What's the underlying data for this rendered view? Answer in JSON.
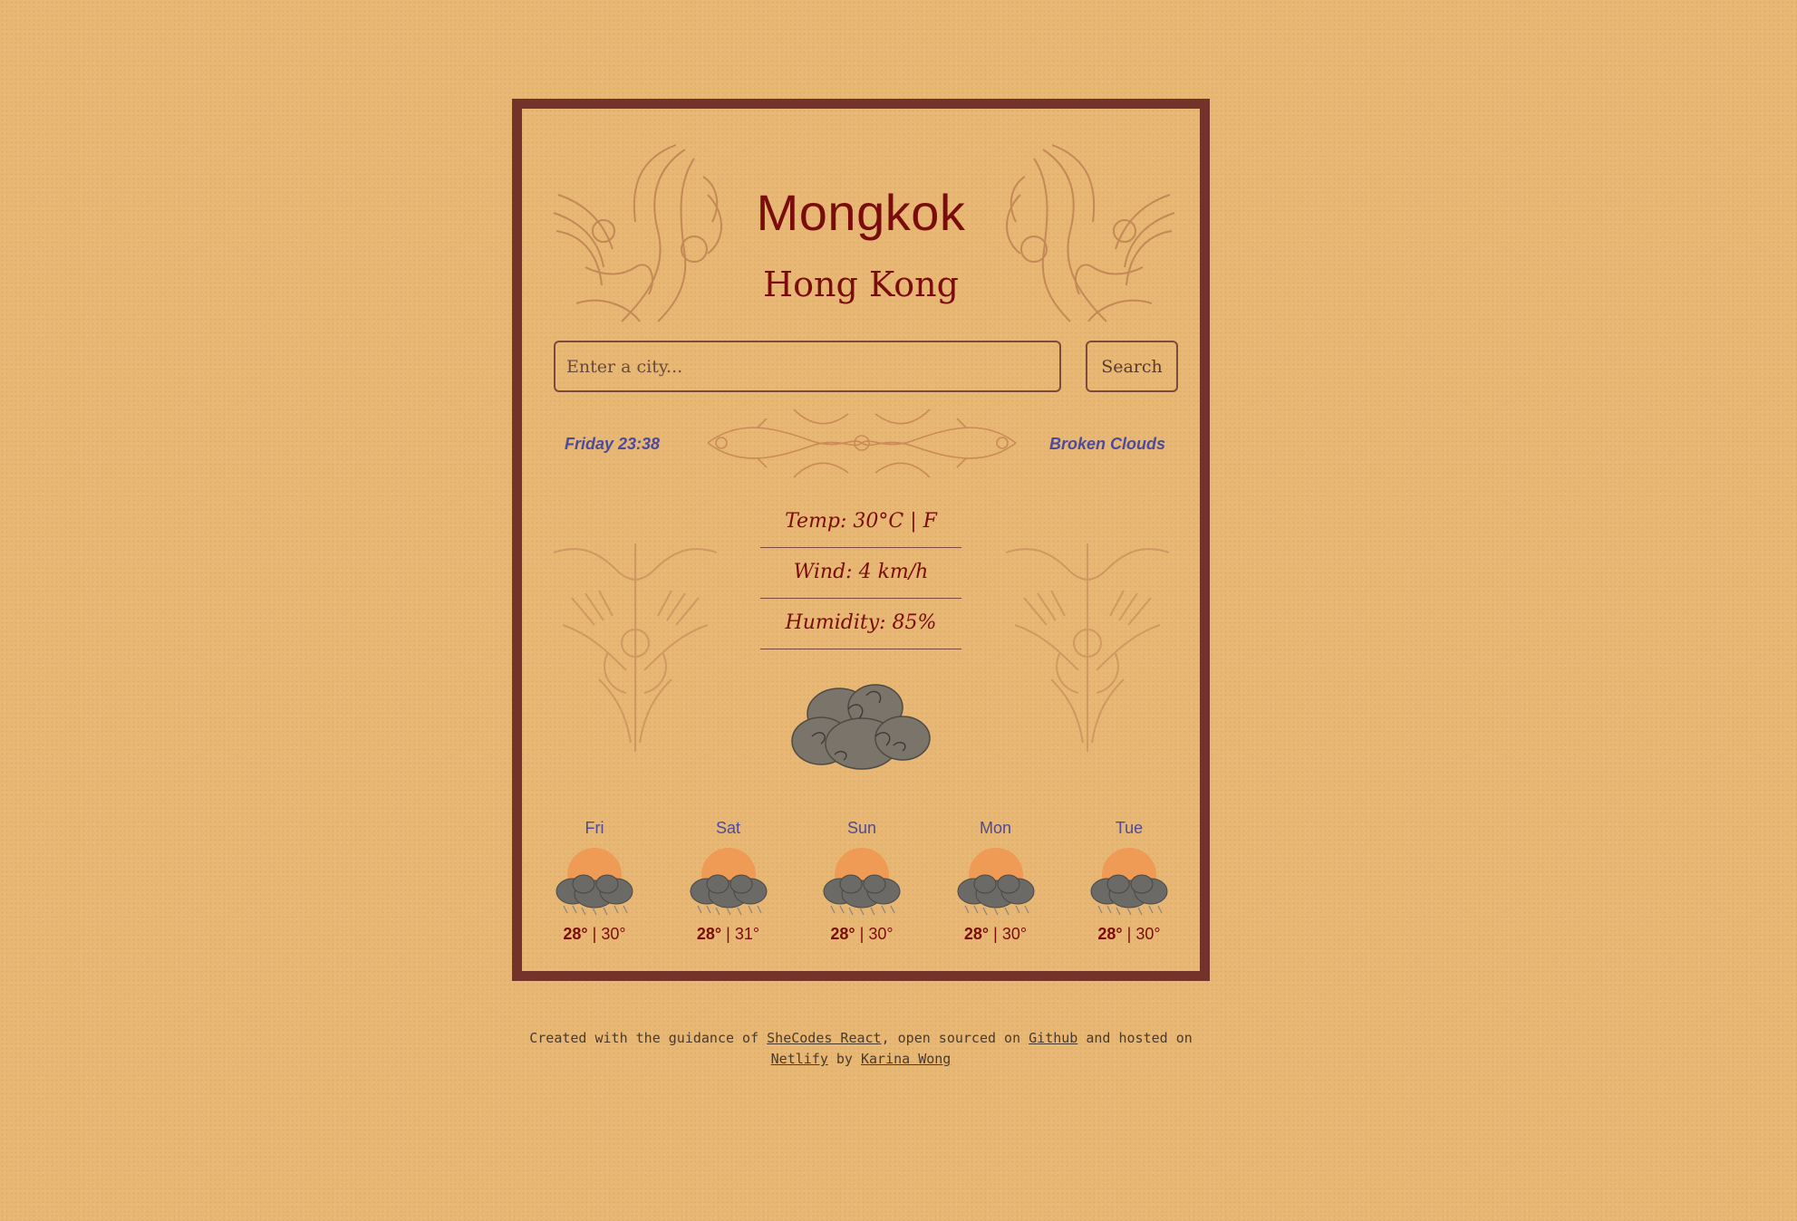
{
  "location": {
    "city": "Mongkok",
    "country": "Hong Kong"
  },
  "search": {
    "placeholder": "Enter a city...",
    "button_label": "Search"
  },
  "current": {
    "datetime": "Friday 23:38",
    "description": "Broken Clouds",
    "temp_label": "Temp: 30°C | F",
    "wind_label": "Wind: 4 km/h",
    "humidity_label": "Humidity: 85%",
    "icon": "broken-clouds-icon"
  },
  "forecast": [
    {
      "day": "Fri",
      "max": "28°",
      "sep": "|",
      "min": "30°",
      "icon": "sun-clouds-icon"
    },
    {
      "day": "Sat",
      "max": "28°",
      "sep": "|",
      "min": "31°",
      "icon": "sun-clouds-icon"
    },
    {
      "day": "Sun",
      "max": "28°",
      "sep": "|",
      "min": "30°",
      "icon": "sun-clouds-icon"
    },
    {
      "day": "Mon",
      "max": "28°",
      "sep": "|",
      "min": "30°",
      "icon": "sun-clouds-icon"
    },
    {
      "day": "Tue",
      "max": "28°",
      "sep": "|",
      "min": "30°",
      "icon": "sun-clouds-icon"
    }
  ],
  "footer": {
    "t1": "Created with the guidance of ",
    "link1": "SheCodes React",
    "t2": ", open sourced on ",
    "link2": "Github",
    "t3": " and hosted on ",
    "link3": "Netlify",
    "t4": " by ",
    "link4": "Karina Wong"
  },
  "colors": {
    "background": "#e8b774",
    "frame": "#74332a",
    "title": "#7a0c0c",
    "accent": "#4d4a9a"
  }
}
